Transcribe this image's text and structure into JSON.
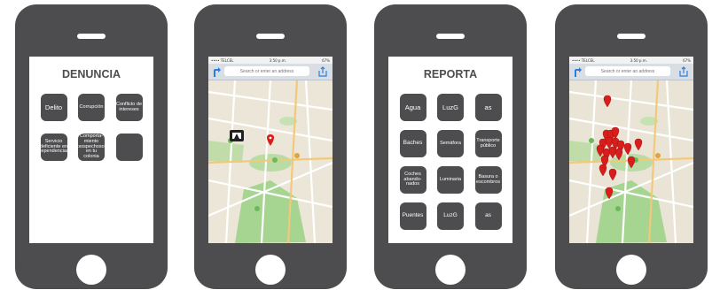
{
  "screens": {
    "denuncia": {
      "title": "DENUNCIA",
      "tiles": [
        "Delito",
        "Corrupción",
        "Conflicto de intereses",
        "Servicio deficiente en dependencias",
        "Comporta-miento sospechoso en tu colonia",
        ""
      ]
    },
    "reporta": {
      "title": "REPORTA",
      "tiles": [
        "Agua",
        "LuzG",
        "as",
        "Baches",
        "Semáfora",
        "Transporte público",
        "Coches abando-nados",
        "Luminaria",
        "Basura o escombros",
        "Puentes",
        "LuzG",
        "as"
      ]
    },
    "map": {
      "carrier": "•••• TELCEL",
      "time": "3:50 p.m.",
      "battery": "67%",
      "search_placeholder": "Search or enter an address"
    }
  },
  "colors": {
    "device": "#4d4d4f",
    "tile": "#4d4d4f",
    "pin": "#d91c1c",
    "park": "#9fd08a"
  },
  "icons": {
    "directions": "directions-arrow-icon",
    "share": "share-icon",
    "pin": "map-pin-icon",
    "alarm": "alarm-report-icon"
  }
}
